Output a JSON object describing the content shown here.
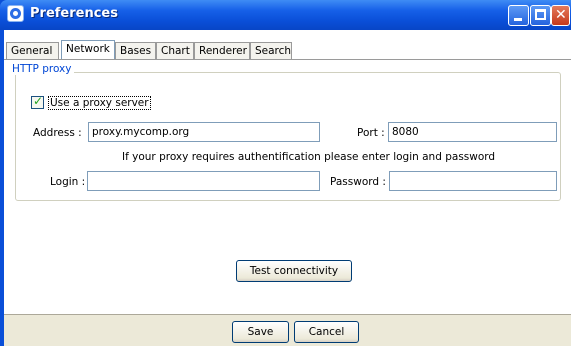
{
  "window": {
    "title": "Preferences"
  },
  "tabs": [
    {
      "label": "General",
      "active": false
    },
    {
      "label": "Network",
      "active": true
    },
    {
      "label": "Bases",
      "active": false
    },
    {
      "label": "Chart",
      "active": false
    },
    {
      "label": "Renderer",
      "active": false
    },
    {
      "label": "Search",
      "active": false
    }
  ],
  "proxy": {
    "group_label": "HTTP proxy",
    "use_proxy_label": "Use a proxy server",
    "use_proxy_checked": true,
    "address_label": "Address :",
    "address_value": "proxy.mycomp.org",
    "port_label": "Port :",
    "port_value": "8080",
    "auth_note": "If your proxy requires authentification please enter login and password",
    "login_label": "Login :",
    "login_value": "",
    "password_label": "Password :",
    "password_value": ""
  },
  "test_button": "Test connectivity",
  "footer": {
    "save": "Save",
    "cancel": "Cancel"
  },
  "colors": {
    "titlebar": "#0a4fd8",
    "group_label": "#0046d5",
    "dialog_bg": "#ece9d8"
  }
}
